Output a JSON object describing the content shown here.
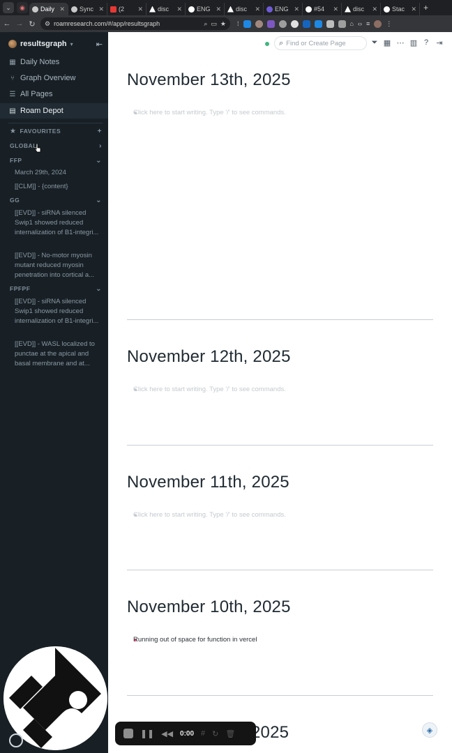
{
  "browser": {
    "tabs": [
      {
        "label": "Daily",
        "color": "#c9c9c9",
        "active": true
      },
      {
        "label": "Sync",
        "color": "#c9c9c9"
      },
      {
        "label": "(2",
        "color": "#e53935"
      },
      {
        "label": "disc",
        "color": "#ffffff"
      },
      {
        "label": "ENG",
        "color": "#ffffff"
      },
      {
        "label": "disc",
        "color": "#ffffff"
      },
      {
        "label": "ENG",
        "color": "#6f5bd6"
      },
      {
        "label": "#54",
        "color": "#ffffff"
      },
      {
        "label": "disc",
        "color": "#ffffff"
      },
      {
        "label": "Stac",
        "color": "#ffffff"
      }
    ],
    "url": "roamresearch.com/#/app/resultsgraph"
  },
  "sidebar": {
    "graph_name": "resultsgraph",
    "nav": [
      {
        "label": "Daily Notes",
        "icon": "calendar-icon"
      },
      {
        "label": "Graph Overview",
        "icon": "graph-icon"
      },
      {
        "label": "All Pages",
        "icon": "list-icon"
      },
      {
        "label": "Roam Depot",
        "icon": "store-icon"
      }
    ],
    "favourites_label": "FAVOURITES",
    "sections": [
      {
        "label": "GLOBAL",
        "items": []
      },
      {
        "label": "FFP",
        "items": [
          "March 29th, 2024",
          "[[CLM]] - {content}"
        ]
      },
      {
        "label": "GG",
        "items": [
          "[[EVD]] - siRNA silenced Swip1 showed reduced internalization of B1-integri...",
          "[[EVD]] - No-motor myosin mutant reduced myosin penetration into cortical a..."
        ]
      },
      {
        "label": "FPFPF",
        "items": [
          "[[EVD]] - siRNA silenced Swip1 showed reduced internalization of B1-integri...",
          "[[EVD]] - WASL localized to punctae at the apical and basal membrane and at..."
        ]
      }
    ]
  },
  "toolbar": {
    "search_placeholder": "Find or Create Page"
  },
  "days": [
    {
      "title": "November 13th, 2025",
      "text": "Click here to start writing. Type '/' to see commands.",
      "filled": false
    },
    {
      "title": "November 12th, 2025",
      "text": "Click here to start writing. Type '/' to see commands.",
      "filled": false
    },
    {
      "title": "November 11th, 2025",
      "text": "Click here to start writing. Type '/' to see commands.",
      "filled": false
    },
    {
      "title": "November 10th, 2025",
      "text": "Running out of space for function in vercel",
      "filled": true
    },
    {
      "title": "2025"
    }
  ],
  "recorder": {
    "time": "0:00"
  }
}
